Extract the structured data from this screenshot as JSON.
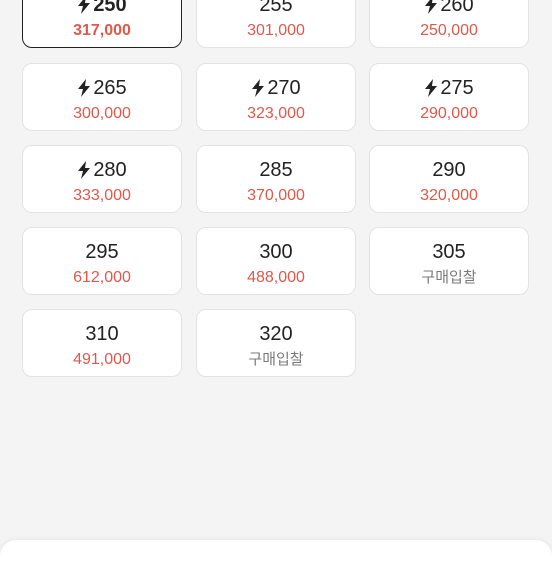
{
  "sizes": [
    {
      "size": "250",
      "price": "317,000",
      "express": true,
      "selected": true,
      "bid": false
    },
    {
      "size": "255",
      "price": "301,000",
      "express": false,
      "selected": false,
      "bid": false
    },
    {
      "size": "260",
      "price": "250,000",
      "express": true,
      "selected": false,
      "bid": false
    },
    {
      "size": "265",
      "price": "300,000",
      "express": true,
      "selected": false,
      "bid": false
    },
    {
      "size": "270",
      "price": "323,000",
      "express": true,
      "selected": false,
      "bid": false
    },
    {
      "size": "275",
      "price": "290,000",
      "express": true,
      "selected": false,
      "bid": false
    },
    {
      "size": "280",
      "price": "333,000",
      "express": true,
      "selected": false,
      "bid": false
    },
    {
      "size": "285",
      "price": "370,000",
      "express": false,
      "selected": false,
      "bid": false
    },
    {
      "size": "290",
      "price": "320,000",
      "express": false,
      "selected": false,
      "bid": false
    },
    {
      "size": "295",
      "price": "612,000",
      "express": false,
      "selected": false,
      "bid": false
    },
    {
      "size": "300",
      "price": "488,000",
      "express": false,
      "selected": false,
      "bid": false
    },
    {
      "size": "305",
      "price": "구매입찰",
      "express": false,
      "selected": false,
      "bid": true
    },
    {
      "size": "310",
      "price": "491,000",
      "express": false,
      "selected": false,
      "bid": false
    },
    {
      "size": "320",
      "price": "구매입찰",
      "express": false,
      "selected": false,
      "bid": true
    }
  ],
  "icons": {
    "express": "lightning-bolt-icon"
  },
  "colors": {
    "price": "#e0584a",
    "bid": "#7a7a7a",
    "selected_border": "#222222"
  }
}
